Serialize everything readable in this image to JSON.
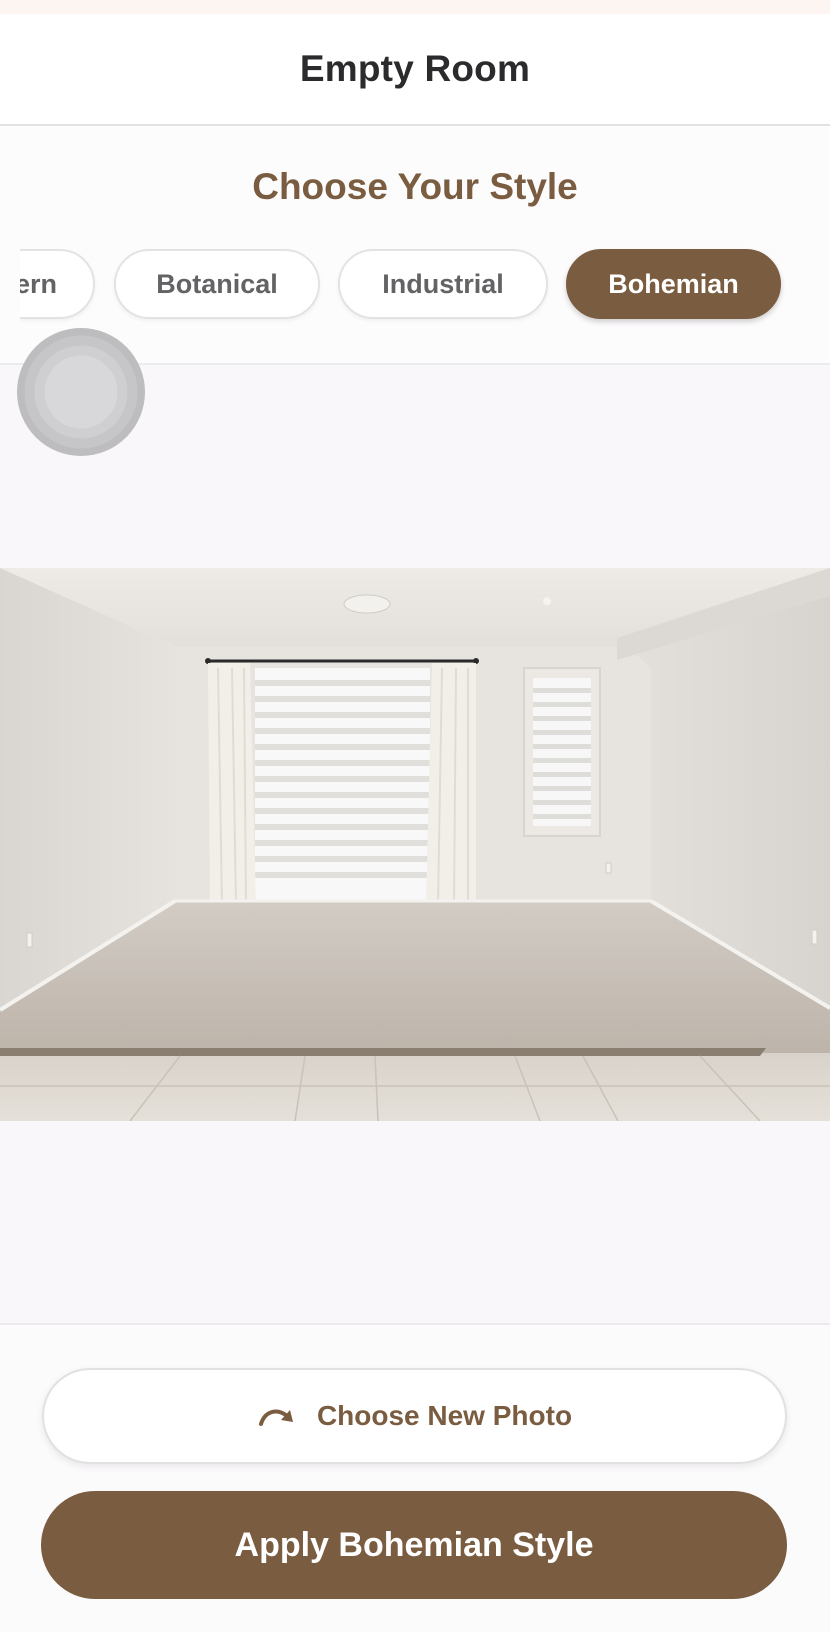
{
  "nav": {
    "title": "Empty Room"
  },
  "style_picker": {
    "heading": "Choose Your Style",
    "options": [
      {
        "label": "ern",
        "selected": false
      },
      {
        "label": "Botanical",
        "selected": false
      },
      {
        "label": "Industrial",
        "selected": false
      },
      {
        "label": "Bohemian",
        "selected": true
      }
    ]
  },
  "photo": {
    "subject": "empty-room-photo"
  },
  "actions": {
    "new_photo_icon": "redo-arrow-icon",
    "new_photo_label": "Choose New Photo",
    "apply_label": "Apply Bohemian Style"
  },
  "colors": {
    "accent": "#7a5c40",
    "title": "#2b2b2d",
    "pill_text": "#636265"
  }
}
